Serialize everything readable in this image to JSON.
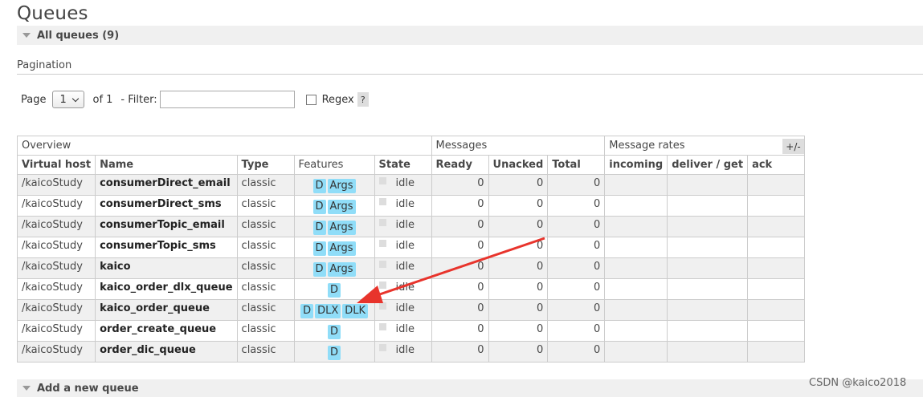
{
  "page": {
    "title": "Queues"
  },
  "all_queues": {
    "label": "All queues (9)"
  },
  "pagination": {
    "label": "Pagination",
    "page_label": "Page",
    "page_value": "1",
    "of_label": "of 1",
    "filter_label": "- Filter:",
    "filter_value": "",
    "regex_label": "Regex",
    "help_label": "?"
  },
  "table": {
    "group_headers": [
      "Overview",
      "Messages",
      "Message rates"
    ],
    "columns": [
      "Virtual host",
      "Name",
      "Type",
      "Features",
      "State",
      "Ready",
      "Unacked",
      "Total",
      "incoming",
      "deliver / get",
      "ack"
    ],
    "toggle_label": "+/-",
    "rows": [
      {
        "vhost": "/kaicoStudy",
        "name": "consumerDirect_email",
        "type": "classic",
        "features": [
          "D",
          "Args"
        ],
        "state": "idle",
        "ready": "0",
        "unacked": "0",
        "total": "0"
      },
      {
        "vhost": "/kaicoStudy",
        "name": "consumerDirect_sms",
        "type": "classic",
        "features": [
          "D",
          "Args"
        ],
        "state": "idle",
        "ready": "0",
        "unacked": "0",
        "total": "0"
      },
      {
        "vhost": "/kaicoStudy",
        "name": "consumerTopic_email",
        "type": "classic",
        "features": [
          "D",
          "Args"
        ],
        "state": "idle",
        "ready": "0",
        "unacked": "0",
        "total": "0"
      },
      {
        "vhost": "/kaicoStudy",
        "name": "consumerTopic_sms",
        "type": "classic",
        "features": [
          "D",
          "Args"
        ],
        "state": "idle",
        "ready": "0",
        "unacked": "0",
        "total": "0"
      },
      {
        "vhost": "/kaicoStudy",
        "name": "kaico",
        "type": "classic",
        "features": [
          "D",
          "Args"
        ],
        "state": "idle",
        "ready": "0",
        "unacked": "0",
        "total": "0"
      },
      {
        "vhost": "/kaicoStudy",
        "name": "kaico_order_dlx_queue",
        "type": "classic",
        "features": [
          "D"
        ],
        "state": "idle",
        "ready": "0",
        "unacked": "0",
        "total": "0"
      },
      {
        "vhost": "/kaicoStudy",
        "name": "kaico_order_queue",
        "type": "classic",
        "features": [
          "D",
          "DLX",
          "DLK"
        ],
        "state": "idle",
        "ready": "0",
        "unacked": "0",
        "total": "0"
      },
      {
        "vhost": "/kaicoStudy",
        "name": "order_create_queue",
        "type": "classic",
        "features": [
          "D"
        ],
        "state": "idle",
        "ready": "0",
        "unacked": "0",
        "total": "0"
      },
      {
        "vhost": "/kaicoStudy",
        "name": "order_dic_queue",
        "type": "classic",
        "features": [
          "D"
        ],
        "state": "idle",
        "ready": "0",
        "unacked": "0",
        "total": "0"
      }
    ]
  },
  "add_queue": {
    "label": "Add a new queue"
  },
  "watermark": "CSDN @kaico2018",
  "colors": {
    "feature_tag": "#90ddf8",
    "annotation_arrow": "#e8342c",
    "odd_row": "#f0f0f0"
  }
}
